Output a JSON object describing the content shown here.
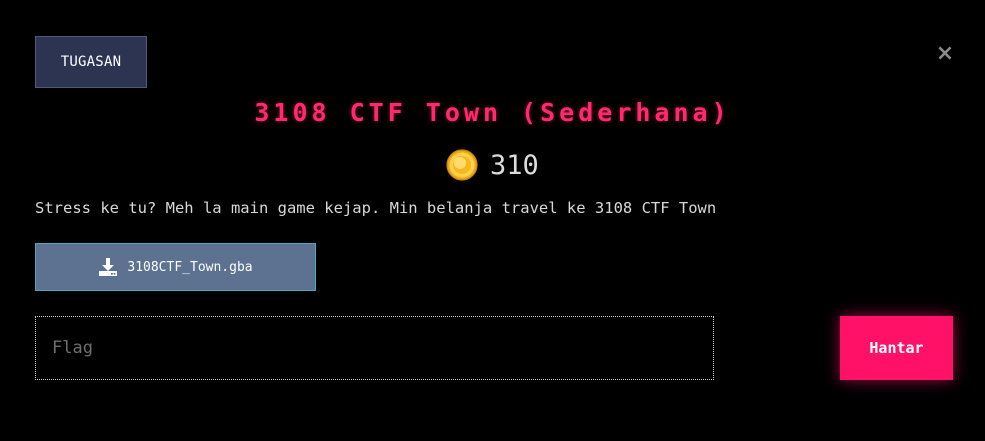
{
  "header": {
    "tab_label": "TUGASAN",
    "close_icon": "close-icon",
    "close_glyph": "×"
  },
  "challenge": {
    "title": "3108 CTF Town (Sederhana)",
    "points": "310",
    "points_icon": "coin-icon",
    "description": "Stress ke tu? Meh la main game kejap. Min belanja travel ke 3108 CTF Town",
    "file": {
      "name": "3108CTF_Town.gba",
      "icon": "download-icon"
    }
  },
  "submission": {
    "flag_placeholder": "Flag",
    "flag_value": "",
    "submit_label": "Hantar"
  },
  "colors": {
    "background": "#000000",
    "title": "#ff2a6d",
    "submit_button": "#ff1168",
    "file_button": "#5c7290",
    "tab_button": "#2c3452"
  }
}
